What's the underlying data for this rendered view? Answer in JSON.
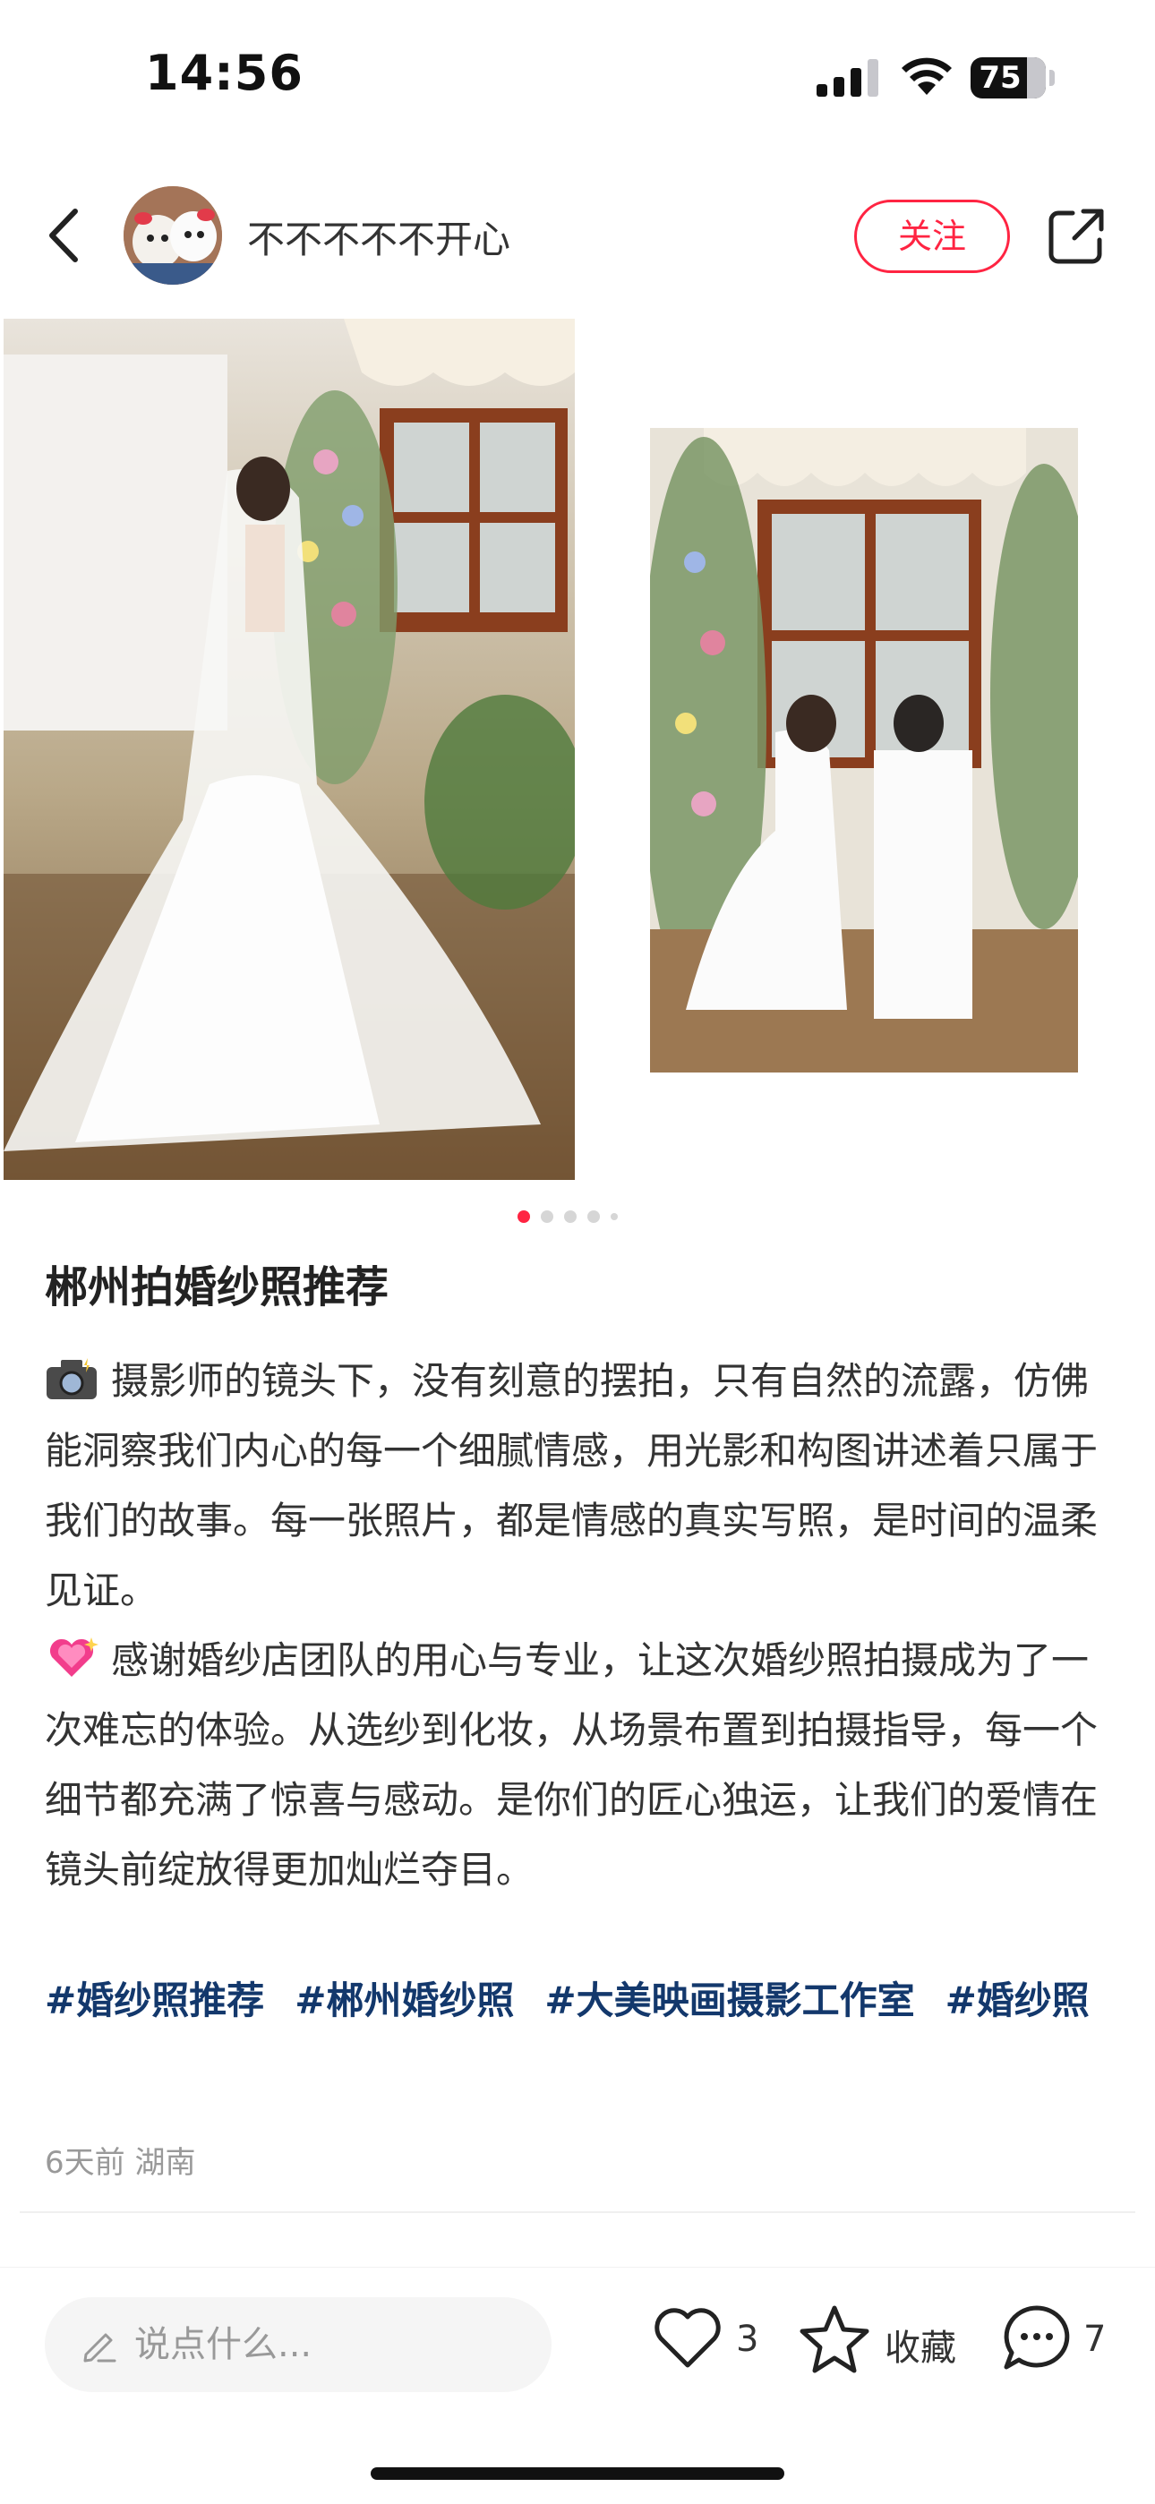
{
  "status_bar": {
    "time": "14:56",
    "battery": "75",
    "battery_level": 0.75
  },
  "header": {
    "username": "不不不不不开心",
    "follow_label": "关注"
  },
  "carousel": {
    "page_count": 5,
    "current_page": 1
  },
  "post": {
    "title": "郴州拍婚纱照推荐",
    "paragraphs": [
      {
        "emoji": "camera-flash-icon",
        "text": "摄影师的镜头下，没有刻意的摆拍，只有自然的流露，仿佛能洞察我们内心的每一个细腻情感，用光影和构图讲述着只属于我们的故事。每一张照片，都是情感的真实写照，是时间的温柔见证。"
      },
      {
        "emoji": "sparkling-heart-icon",
        "text": "感谢婚纱店团队的用心与专业，让这次婚纱照拍摄成为了一次难忘的体验。从选纱到化妆，从场景布置到拍摄指导，每一个细节都充满了惊喜与感动。是你们的匠心独运，让我们的爱情在镜头前绽放得更加灿烂夺目。"
      }
    ],
    "tags": [
      "#婚纱照推荐",
      "#郴州婚纱照",
      "#大美映画摄影工作室",
      "#婚纱照"
    ],
    "meta": "6天前 湖南"
  },
  "bottom_bar": {
    "comment_placeholder": "说点什么...",
    "like_count": "3",
    "collect_label": "收藏",
    "comment_count": "7"
  },
  "colors": {
    "accent": "#ff2442",
    "tag": "#13386c"
  }
}
